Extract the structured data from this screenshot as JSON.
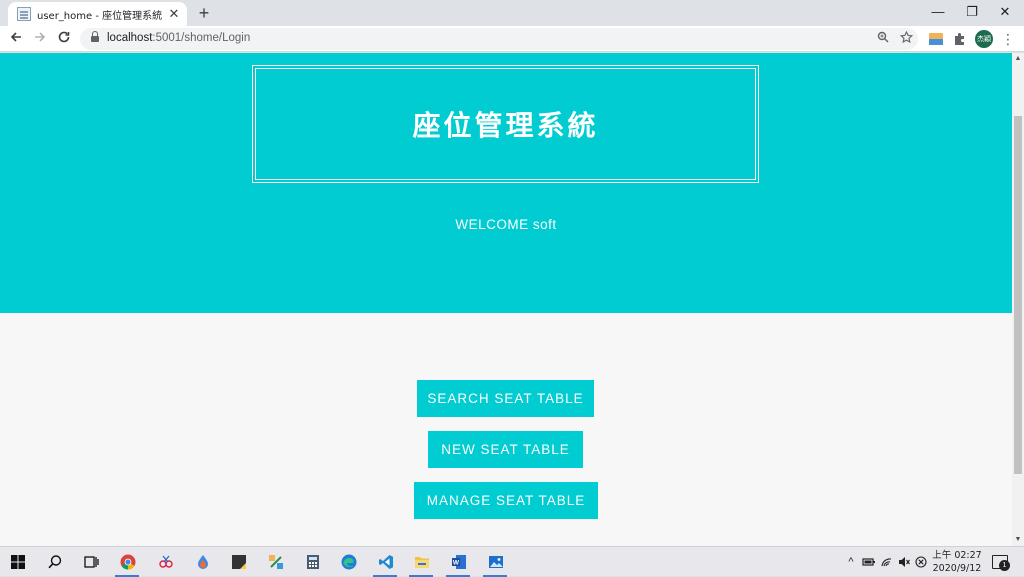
{
  "browser": {
    "tab_title": "user_home - 座位管理系統",
    "tab_close": "✕",
    "new_tab": "+",
    "url_host": "localhost",
    "url_path": ":5001/shome/Login",
    "avatar_text": "杰穎",
    "window_controls": {
      "minimize": "—",
      "restore": "❐",
      "close": "✕"
    }
  },
  "page": {
    "title": "座位管理系統",
    "welcome": "WELCOME soft",
    "buttons": {
      "search": "SEARCH SEAT TABLE",
      "new": "NEW SEAT TABLE",
      "manage": "MANAGE SEAT TABLE"
    }
  },
  "taskbar": {
    "clock_period_time": "上午 02:27",
    "date": "2020/9/12",
    "notification_count": "1"
  },
  "colors": {
    "accent": "#00ccd1",
    "page_bg": "#f7f7f7"
  }
}
